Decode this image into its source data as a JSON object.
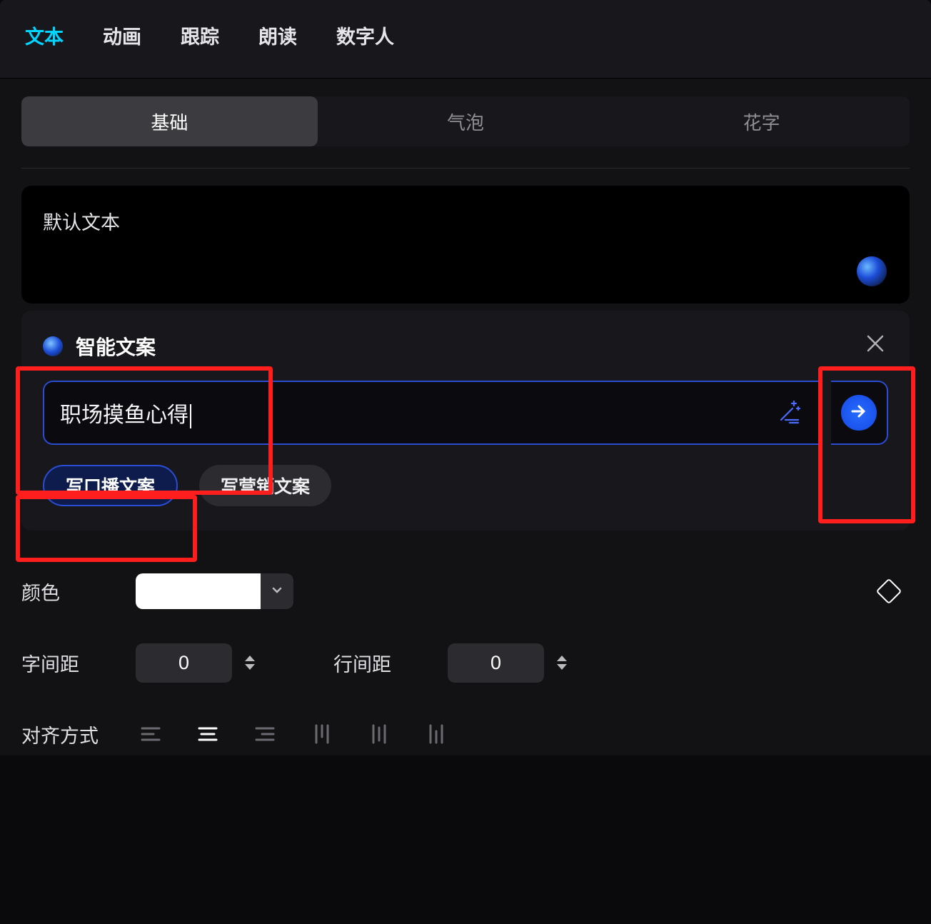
{
  "topTabs": {
    "text": "文本",
    "animation": "动画",
    "tracking": "跟踪",
    "read": "朗读",
    "digital": "数字人",
    "active": "text"
  },
  "subTabs": {
    "basic": "基础",
    "bubble": "气泡",
    "fancy": "花字",
    "active": "basic"
  },
  "textArea": {
    "placeholder": "默认文本"
  },
  "smartCopy": {
    "title": "智能文案",
    "prompt_value": "职场摸鱼心得",
    "chips": {
      "broadcast": "写口播文案",
      "marketing": "写营销文案",
      "active": "broadcast"
    }
  },
  "props": {
    "color_label": "颜色",
    "color_value": "#FFFFFF",
    "letter_spacing_label": "字间距",
    "letter_spacing_value": "0",
    "line_spacing_label": "行间距",
    "line_spacing_value": "0",
    "align_label": "对齐方式"
  }
}
